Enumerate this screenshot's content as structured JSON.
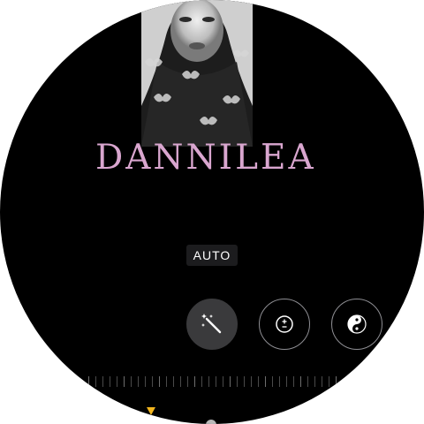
{
  "photo": {
    "brand_text": "DANNILEA"
  },
  "edit_mode": {
    "label": "AUTO"
  },
  "tools": [
    {
      "name": "auto-enhance",
      "icon": "magic-wand-icon",
      "selected": true
    },
    {
      "name": "exposure",
      "icon": "exposure-plus-minus-icon",
      "selected": false
    },
    {
      "name": "black-and-white",
      "icon": "yin-yang-icon",
      "selected": false
    }
  ],
  "colors": {
    "background": "#000000",
    "brand_text": "#d9a6cf",
    "selected_tool": "#3a3a3c",
    "indicator": "#f2b51e"
  }
}
